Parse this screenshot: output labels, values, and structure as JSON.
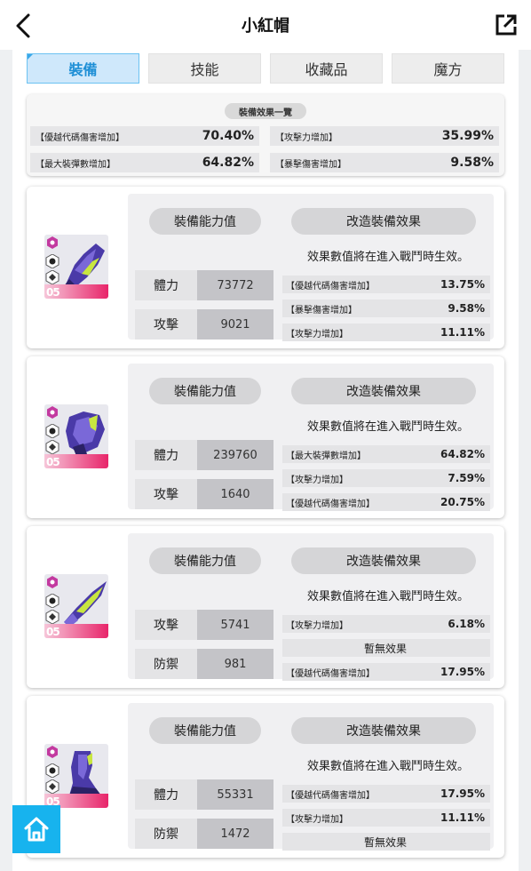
{
  "header": {
    "title": "小紅帽"
  },
  "tabs": [
    {
      "label": "裝備"
    },
    {
      "label": "技能"
    },
    {
      "label": "收藏品"
    },
    {
      "label": "魔方"
    }
  ],
  "summary": {
    "title": "裝備效果一覽",
    "items": [
      {
        "label": "【優越代碼傷害增加】",
        "value": "70.40%"
      },
      {
        "label": "【攻擊力增加】",
        "value": "35.99%"
      },
      {
        "label": "【最大裝彈數增加】",
        "value": "64.82%"
      },
      {
        "label": "【暴擊傷害增加】",
        "value": "9.58%"
      }
    ]
  },
  "cards": [
    {
      "level": "05",
      "stats_title": "裝備能力值",
      "effects_title": "改造裝備效果",
      "note": "效果數值將在進入戰鬥時生效。",
      "stats": [
        {
          "label": "體力",
          "value": "73772"
        },
        {
          "label": "攻擊",
          "value": "9021"
        }
      ],
      "effects": [
        {
          "label": "【優越代碼傷害增加】",
          "value": "13.75%"
        },
        {
          "label": "【暴擊傷害增加】",
          "value": "9.58%"
        },
        {
          "label": "【攻擊力增加】",
          "value": "11.11%"
        }
      ]
    },
    {
      "level": "05",
      "stats_title": "裝備能力值",
      "effects_title": "改造裝備效果",
      "note": "效果數值將在進入戰鬥時生效。",
      "stats": [
        {
          "label": "體力",
          "value": "239760"
        },
        {
          "label": "攻擊",
          "value": "1640"
        }
      ],
      "effects": [
        {
          "label": "【最大裝彈數增加】",
          "value": "64.82%"
        },
        {
          "label": "【攻擊力增加】",
          "value": "7.59%"
        },
        {
          "label": "【優越代碼傷害增加】",
          "value": "20.75%"
        }
      ]
    },
    {
      "level": "05",
      "stats_title": "裝備能力值",
      "effects_title": "改造裝備效果",
      "note": "效果數值將在進入戰鬥時生效。",
      "stats": [
        {
          "label": "攻擊",
          "value": "5741"
        },
        {
          "label": "防禦",
          "value": "981"
        }
      ],
      "effects": [
        {
          "label": "【攻擊力增加】",
          "value": "6.18%"
        },
        {
          "label": "暫無效果",
          "value": ""
        },
        {
          "label": "【優越代碼傷害增加】",
          "value": "17.95%"
        }
      ]
    },
    {
      "level": "05",
      "stats_title": "裝備能力值",
      "effects_title": "改造裝備效果",
      "note": "效果數值將在進入戰鬥時生效。",
      "stats": [
        {
          "label": "體力",
          "value": "55331"
        },
        {
          "label": "防禦",
          "value": "1472"
        }
      ],
      "effects": [
        {
          "label": "【優越代碼傷害增加】",
          "value": "17.95%"
        },
        {
          "label": "【攻擊力增加】",
          "value": "11.11%"
        },
        {
          "label": "暫無效果",
          "value": ""
        }
      ]
    }
  ],
  "colors": {
    "accent": "#1e8fd6",
    "tab_active_bg": "#cfe8fb",
    "home_button": "#17b3ee",
    "level_bar": "#e8256a"
  }
}
